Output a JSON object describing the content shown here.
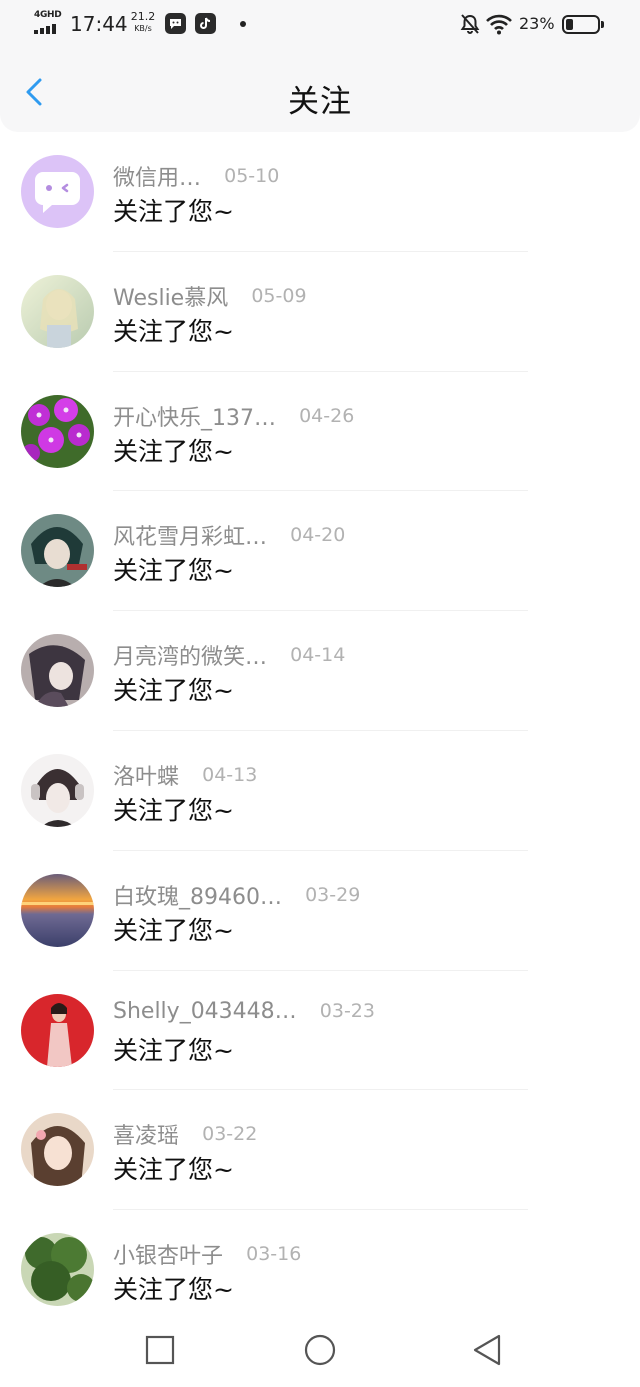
{
  "status_bar": {
    "network": "4GHD",
    "time": "17:44",
    "speed_value": "21.2",
    "speed_unit": "KB/s",
    "battery_percent": "23%",
    "battery_level": 0.23,
    "icons": [
      "signal-icon",
      "chat-app-icon",
      "tiktok-icon",
      "notification-dot",
      "mute-bell-icon",
      "wifi-icon",
      "battery-icon"
    ]
  },
  "header": {
    "title": "关注",
    "back_icon": "chevron-left-icon",
    "accent_color": "#2f9bf0"
  },
  "followers": [
    {
      "name": "微信用…",
      "date": "05-10",
      "message": "关注了您~",
      "avatar": "default-wechat-avatar"
    },
    {
      "name": "Weslie慕风",
      "date": "05-09",
      "message": "关注了您~",
      "avatar": "anime-girl-light-avatar"
    },
    {
      "name": "开心快乐_137…",
      "date": "04-26",
      "message": "关注了您~",
      "avatar": "purple-flowers-avatar"
    },
    {
      "name": "风花雪月彩虹…",
      "date": "04-20",
      "message": "关注了您~",
      "avatar": "anime-boy-green-avatar"
    },
    {
      "name": "月亮湾的微笑…",
      "date": "04-14",
      "message": "关注了您~",
      "avatar": "anime-dark-avatar"
    },
    {
      "name": "洛叶蝶",
      "date": "04-13",
      "message": "关注了您~",
      "avatar": "anime-headphones-avatar"
    },
    {
      "name": "白玫瑰_89460…",
      "date": "03-29",
      "message": "关注了您~",
      "avatar": "sunset-sea-avatar"
    },
    {
      "name": "Shelly_043448…",
      "date": "03-23",
      "message": "关注了您~",
      "avatar": "woman-red-background-avatar"
    },
    {
      "name": "喜凌瑶",
      "date": "03-22",
      "message": "关注了您~",
      "avatar": "girl-portrait-avatar"
    },
    {
      "name": "小银杏叶子",
      "date": "03-16",
      "message": "关注了您~",
      "avatar": "green-tree-avatar"
    }
  ],
  "nav_bar": {
    "icons": [
      "recent-apps-icon",
      "home-icon",
      "back-triangle-icon"
    ]
  }
}
